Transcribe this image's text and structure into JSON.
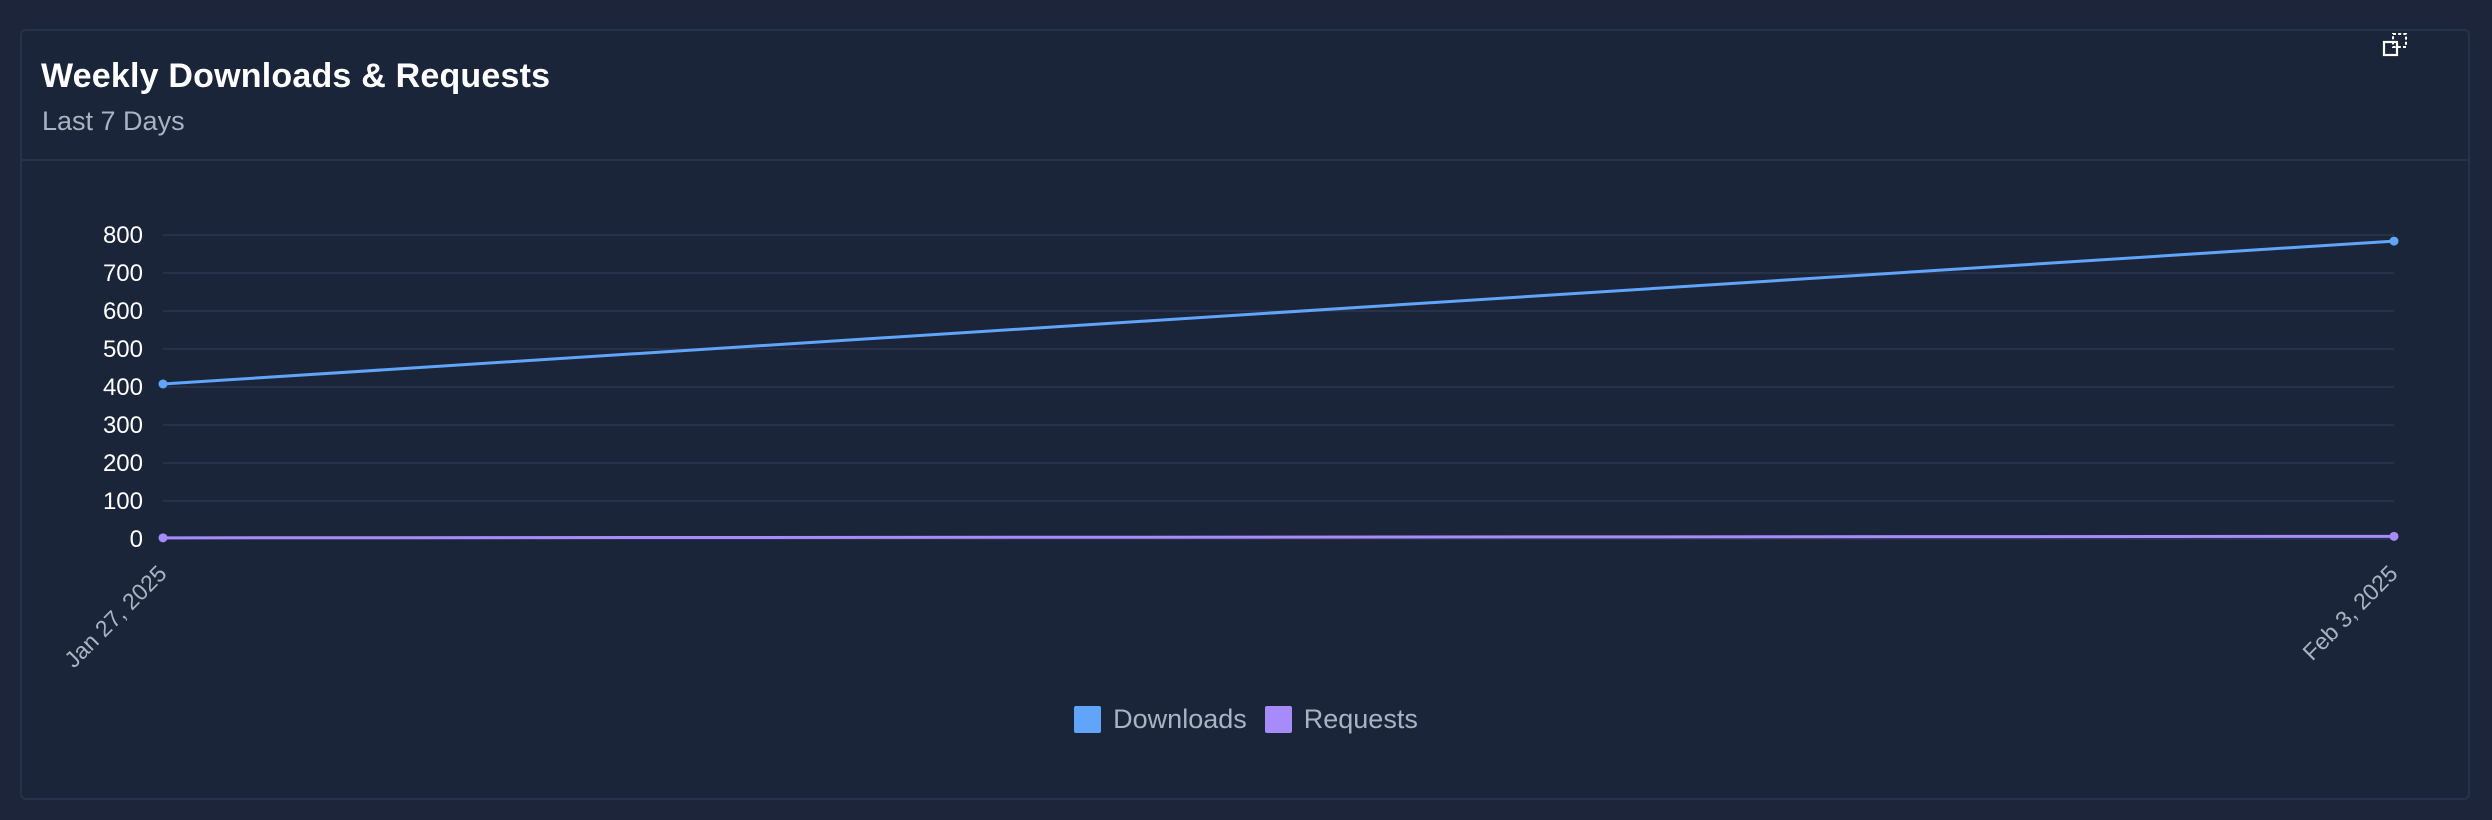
{
  "card": {
    "title": "Weekly Downloads & Requests",
    "subtitle": "Last 7 Days",
    "expand_icon": "expand-icon"
  },
  "chart_data": {
    "type": "line",
    "title": "Weekly Downloads & Requests",
    "subtitle": "Last 7 Days",
    "x": [
      "Jan 27, 2025",
      "Feb 3, 2025"
    ],
    "ylim": [
      0,
      800
    ],
    "yticks": [
      "0",
      "100",
      "200",
      "300",
      "400",
      "500",
      "600",
      "700",
      "800"
    ],
    "grid": true,
    "legend_position": "bottom",
    "series": [
      {
        "name": "Downloads",
        "values": [
          408,
          784
        ],
        "color": "#60a5fa"
      },
      {
        "name": "Requests",
        "values": [
          3,
          7
        ],
        "color": "#a78bfa"
      }
    ]
  },
  "colors": {
    "background": "#1c2539",
    "card": "#1b2539",
    "border": "#263249",
    "grid": "#2a3751"
  }
}
